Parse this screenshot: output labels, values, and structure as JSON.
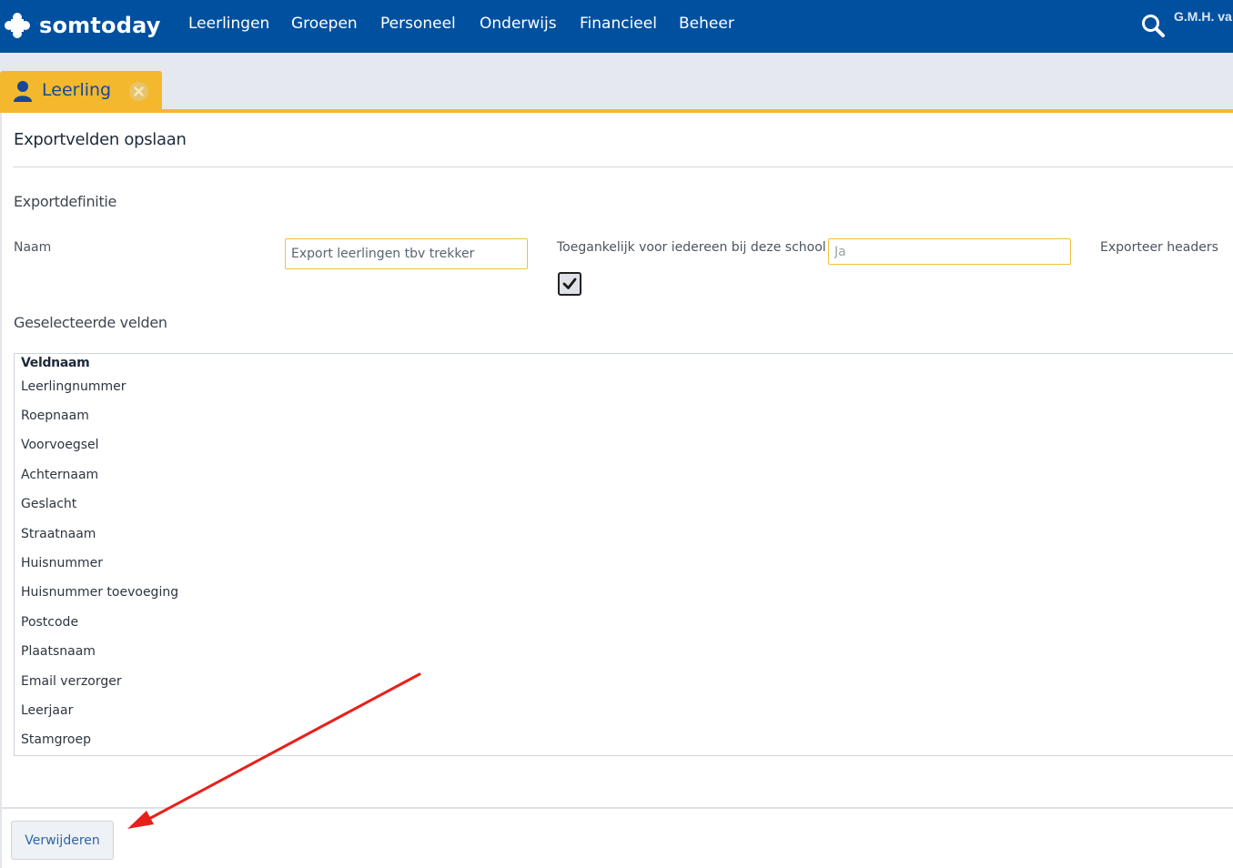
{
  "header": {
    "brand": "somtoday",
    "nav": [
      {
        "label": "Leerlingen"
      },
      {
        "label": "Groepen"
      },
      {
        "label": "Personeel"
      },
      {
        "label": "Onderwijs"
      },
      {
        "label": "Financieel"
      },
      {
        "label": "Beheer"
      }
    ],
    "user": "G.M.H. va",
    "accent": "#0050a0"
  },
  "tabs": [
    {
      "label": "Leerling",
      "icon": "user-icon",
      "color": "#f3b82d"
    }
  ],
  "page": {
    "title": "Exportvelden opslaan",
    "section_definition": "Exportdefinitie",
    "fields": {
      "naam_label": "Naam",
      "naam_value": "Export leerlingen tbv trekker",
      "toegankelijk_label": "Toegankelijk voor iedereen bij deze school",
      "toegankelijk_value": "Ja",
      "exporteer_label": "Exporteer headers",
      "exporteer_checked": true
    },
    "section_selected": "Geselecteerde velden",
    "table": {
      "header": "Veldnaam",
      "rows": [
        "Leerlingnummer",
        "Roepnaam",
        "Voorvoegsel",
        "Achternaam",
        "Geslacht",
        "Straatnaam",
        "Huisnummer",
        "Huisnummer toevoeging",
        "Postcode",
        "Plaatsnaam",
        "Email verzorger",
        "Leerjaar",
        "Stamgroep"
      ]
    },
    "delete_button": "Verwijderen"
  },
  "annotation": {
    "arrow_color": "#e8201a",
    "points_to": "delete-button"
  }
}
